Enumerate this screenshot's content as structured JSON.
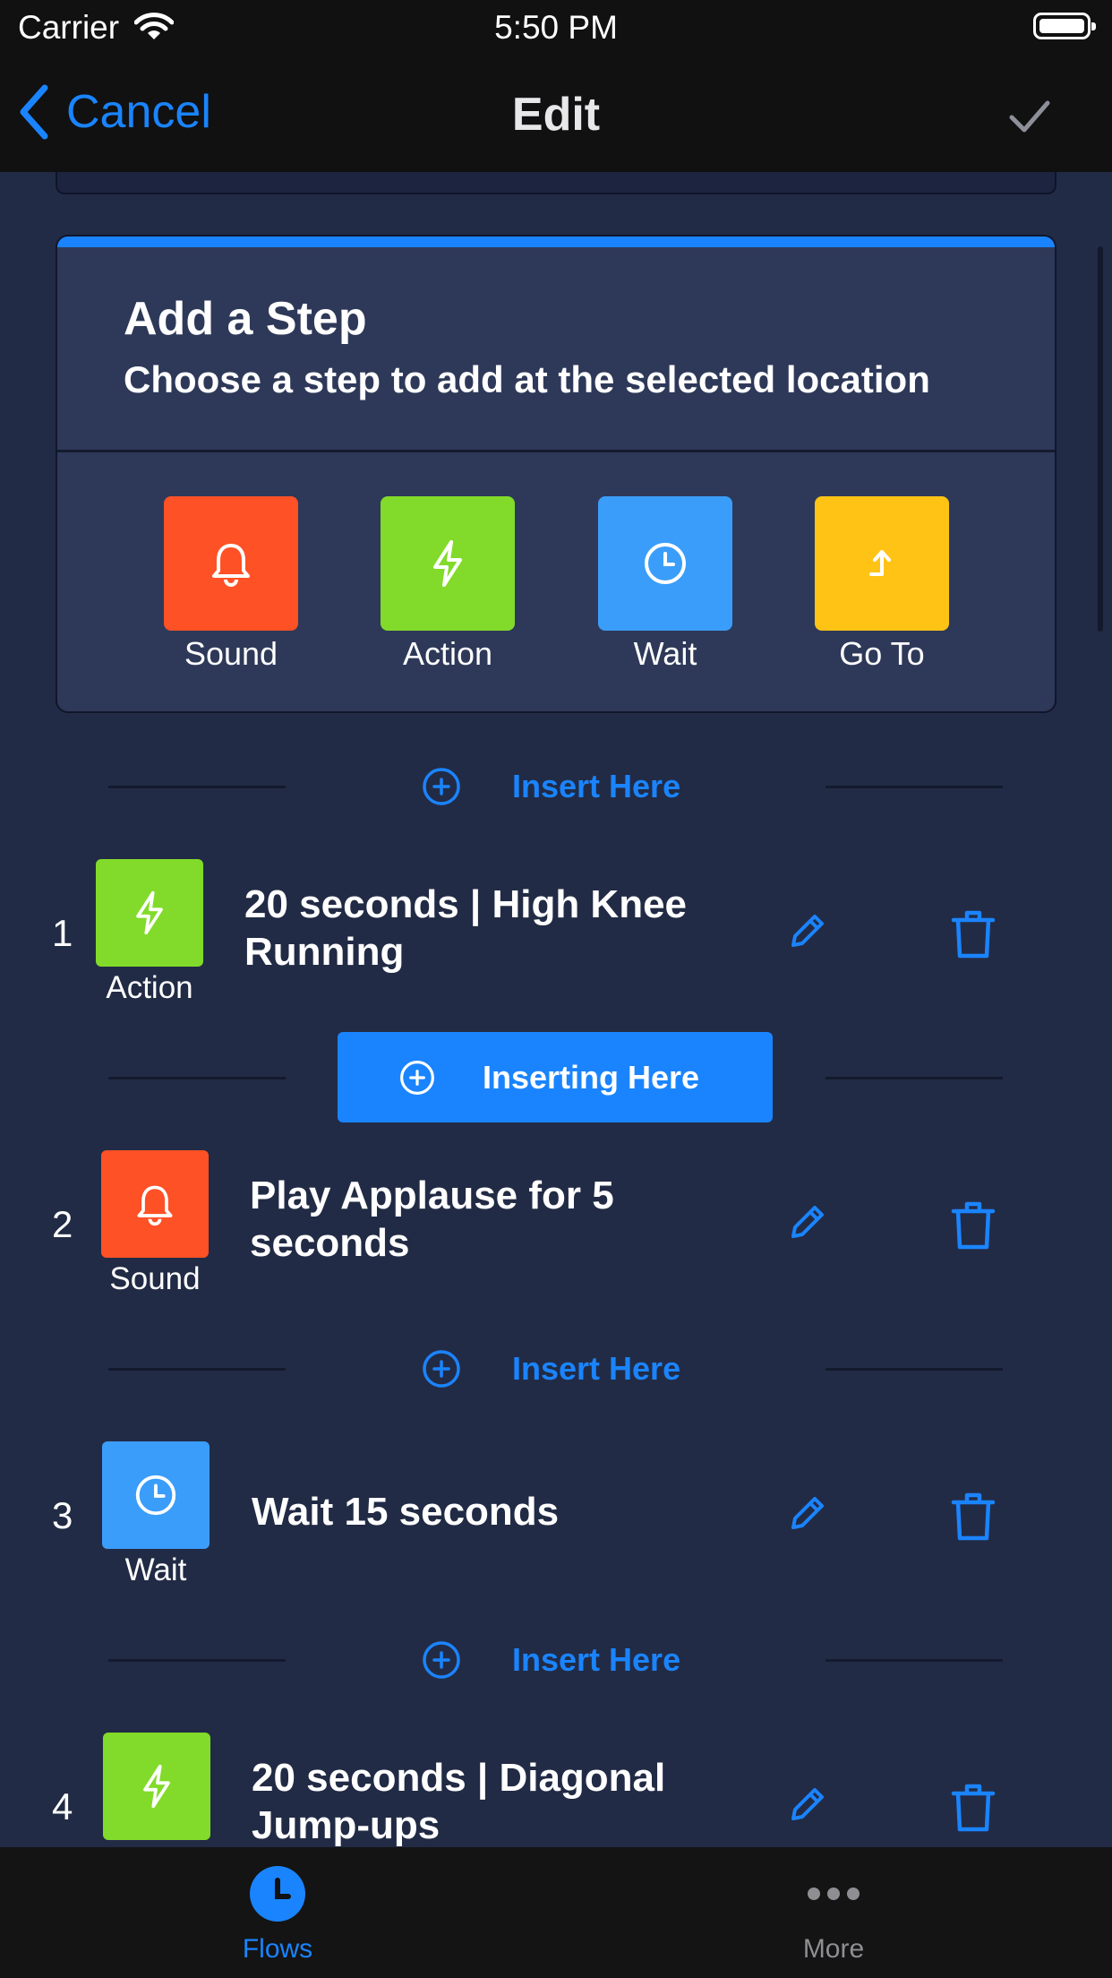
{
  "status": {
    "carrier": "Carrier",
    "time": "5:50 PM"
  },
  "nav": {
    "back_label": "Cancel",
    "title": "Edit"
  },
  "add_step": {
    "title": "Add a Step",
    "subtitle": "Choose a step to add at the selected location",
    "options": [
      {
        "label": "Sound",
        "icon": "bell-icon",
        "color": "#ff5126"
      },
      {
        "label": "Action",
        "icon": "lightning-icon",
        "color": "#82db2a"
      },
      {
        "label": "Wait",
        "icon": "clock-icon",
        "color": "#3b9dfa"
      },
      {
        "label": "Go To",
        "icon": "goto-arrow-icon",
        "color": "#ffc315"
      }
    ]
  },
  "insert": {
    "label": "Insert Here",
    "active_label": "Inserting Here"
  },
  "steps": [
    {
      "number": "1",
      "type": "Action",
      "icon": "lightning-icon",
      "color": "#82db2a",
      "text": "20 seconds | High Knee Running"
    },
    {
      "number": "2",
      "type": "Sound",
      "icon": "bell-icon",
      "color": "#ff5126",
      "text": "Play Applause for 5 seconds"
    },
    {
      "number": "3",
      "type": "Wait",
      "icon": "clock-icon",
      "color": "#3b9dfa",
      "text": "Wait 15 seconds"
    },
    {
      "number": "4",
      "type": "Action",
      "icon": "lightning-icon",
      "color": "#82db2a",
      "text": "20 seconds | Diagonal Jump-ups"
    }
  ],
  "tabs": [
    {
      "label": "Flows",
      "icon": "clock-icon",
      "active": true
    },
    {
      "label": "More",
      "icon": "more-dots-icon",
      "active": false
    }
  ],
  "colors": {
    "accent": "#1a84ff",
    "background": "#222b45",
    "card": "#2e3959",
    "bar": "#111111"
  }
}
